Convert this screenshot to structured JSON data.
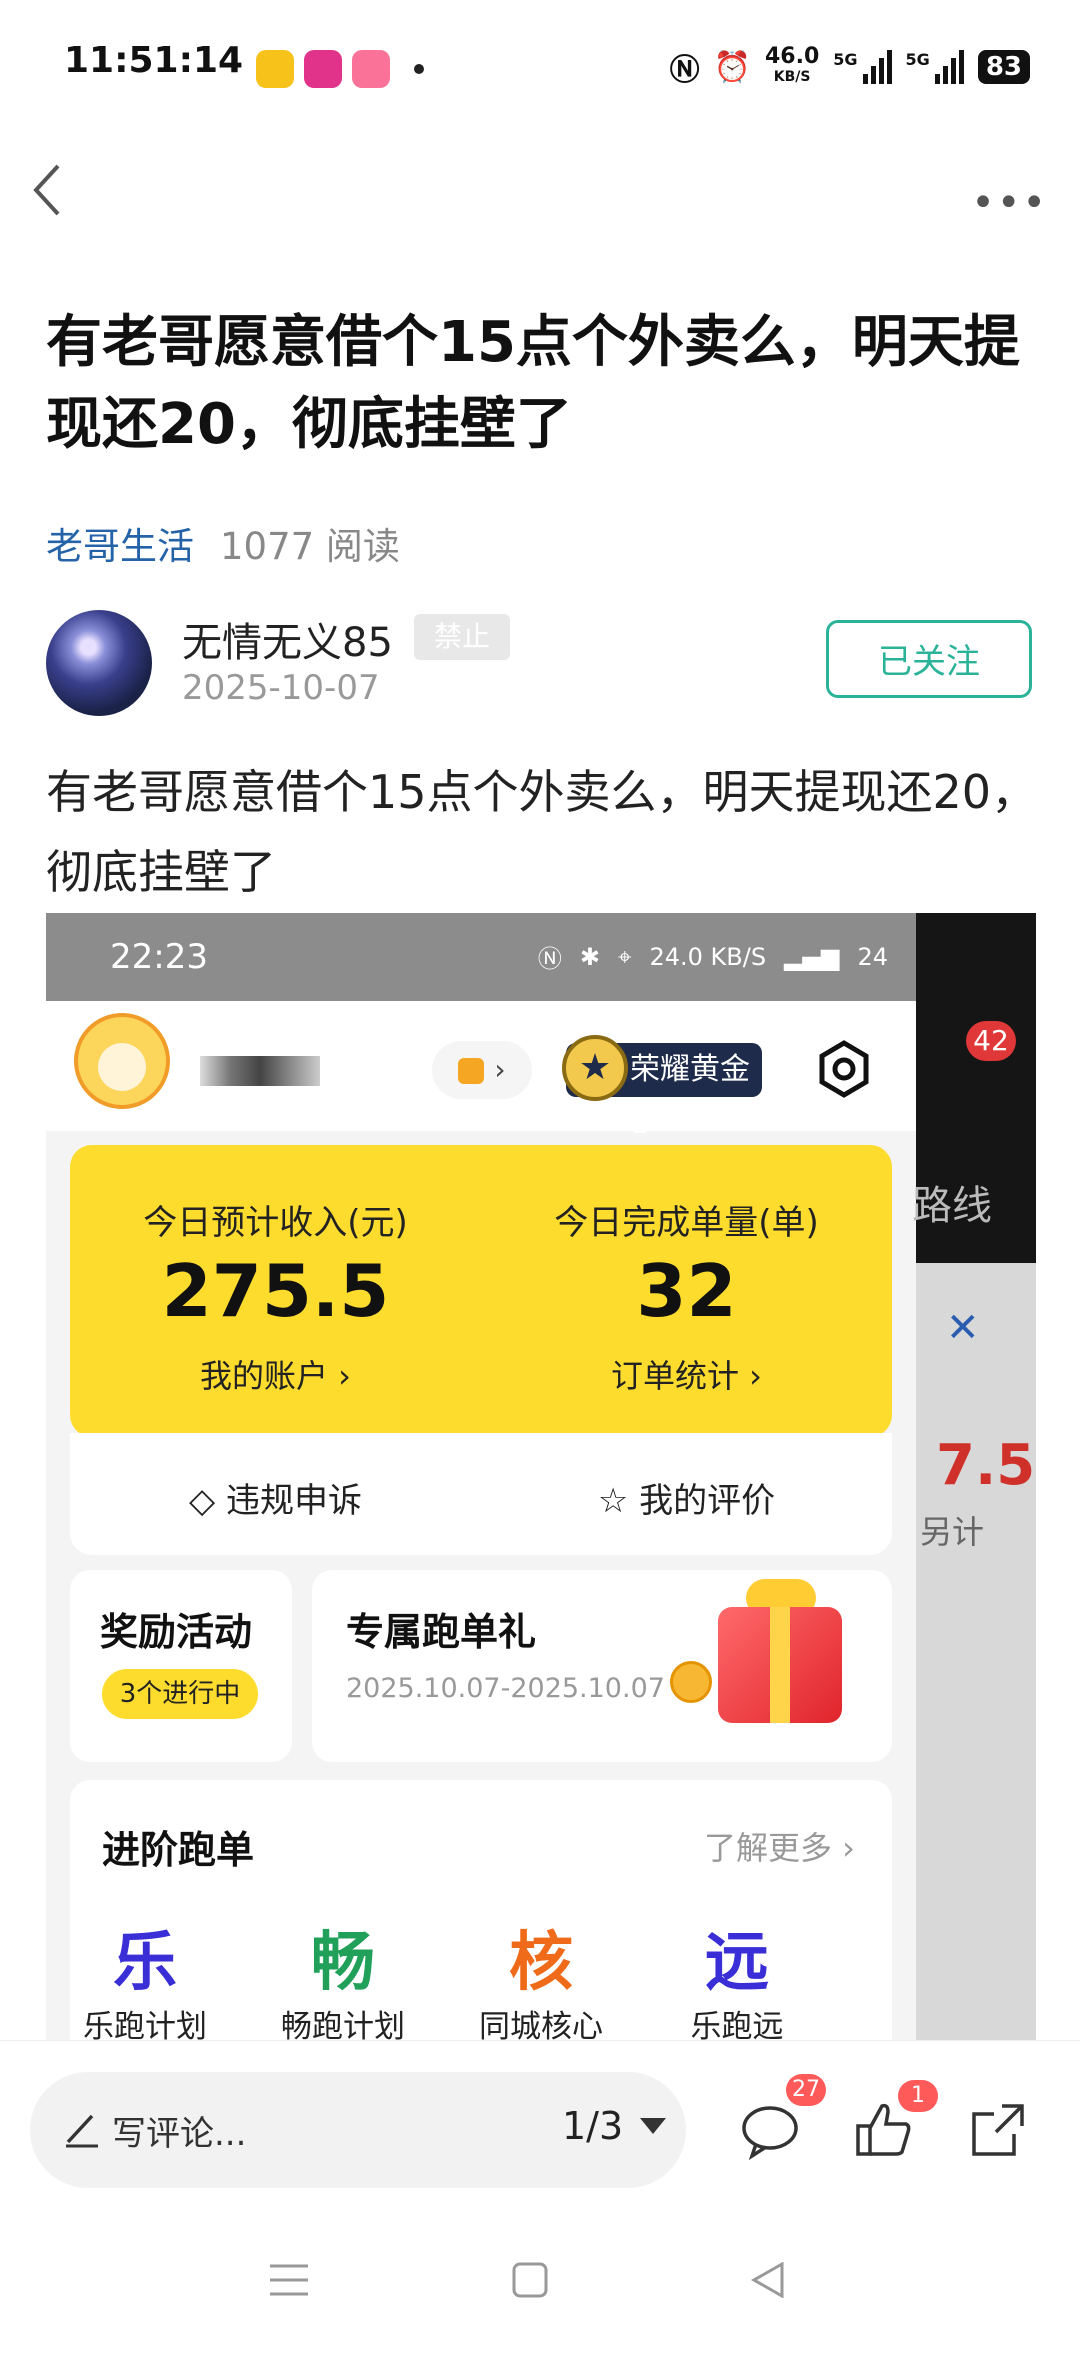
{
  "status_bar": {
    "time": "11:51:14",
    "net_speed": "46.0",
    "net_unit": "KB/S",
    "sig1": "5G",
    "sig2": "5G",
    "battery": "83"
  },
  "post": {
    "title": "有老哥愿意借个15点个外卖么，明天提现还20，彻底挂壁了",
    "category": "老哥生活",
    "reads": "1077 阅读",
    "author": "无情无义85",
    "author_tag": "禁止",
    "date": "2025-10-07",
    "follow_label": "已关注",
    "body": "有老哥愿意借个15点个外卖么，明天提现还20，彻底挂壁了"
  },
  "screenshot": {
    "status_time": "22:23",
    "status_speed": "24.0",
    "status_speed_unit": "KB/S",
    "status_battery": "24",
    "notify_count": "42",
    "side_text": "路线",
    "side_red": "7.5",
    "side_small": "另计",
    "rank": "荣耀黄金1",
    "income_label": "今日预计收入(元)",
    "income_value": "275.5",
    "account_link": "我的账户 ›",
    "orders_label": "今日完成单量(单)",
    "orders_value": "32",
    "orders_link": "订单统计 ›",
    "appeal": "违规申诉",
    "rating": "我的评价",
    "reward_title": "奖励活动",
    "reward_pill": "3个进行中",
    "exclusive_title": "专属跑单礼",
    "exclusive_date": "2025.10.07-2025.10.07",
    "advanced_title": "进阶跑单",
    "advanced_more": "了解更多 ›",
    "plans": [
      {
        "icon": "乐",
        "label": "乐跑计划",
        "color": "#3a2fd6"
      },
      {
        "icon": "畅",
        "label": "畅跑计划",
        "color": "#21a05a"
      },
      {
        "icon": "核",
        "label": "同城核心",
        "color": "#ef6b1a"
      },
      {
        "icon": "远",
        "label": "乐跑远",
        "color": "#3a2fd6"
      }
    ]
  },
  "bottom": {
    "comment_placeholder": "写评论...",
    "pager": "1/3",
    "comment_count": "27",
    "like_count": "1"
  },
  "colors": {
    "accent": "#2bb39a",
    "category": "#2563a8",
    "yellow": "#fedc2e",
    "badge": "#ff5a5a"
  }
}
